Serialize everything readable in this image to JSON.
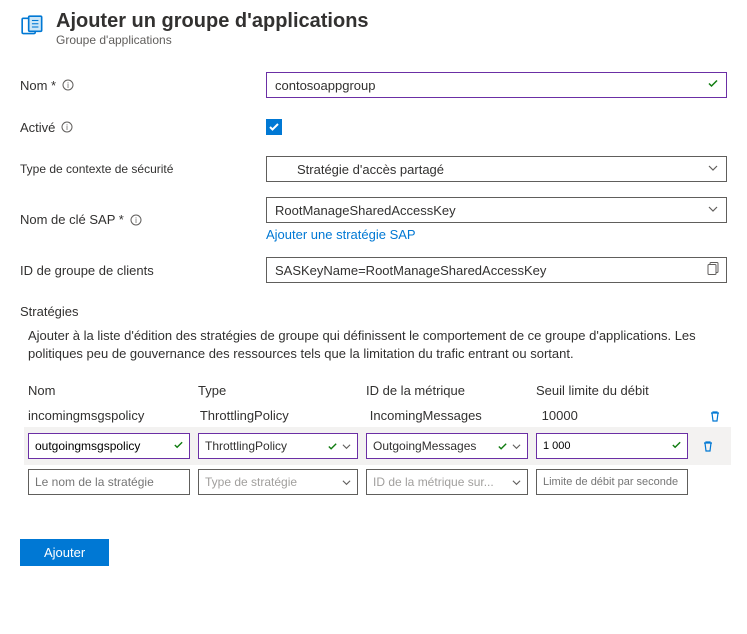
{
  "header": {
    "title": "Ajouter un groupe d'applications",
    "subtitle": "Groupe d'applications"
  },
  "fields": {
    "name_label": "Nom *",
    "name_value": "contosoappgroup",
    "enabled_label": "Activé",
    "enabled_checked": true,
    "context_label": "Type de contexte de sécurité",
    "context_value": "Stratégie d'accès partagé",
    "sap_label": "Nom de clé SAP *",
    "sap_value": "RootManageSharedAccessKey",
    "sap_link": "Ajouter une stratégie SAP",
    "client_label": "ID de groupe de clients",
    "client_value": "SASKeyName=RootManageSharedAccessKey"
  },
  "policies": {
    "section_title": "Stratégies",
    "section_desc": "Ajouter à la liste d'édition des stratégies de groupe qui définissent le comportement de ce groupe d'applications. Les politiques peu de gouvernance des ressources tels que la limitation du trafic entrant ou sortant.",
    "headers": {
      "name": "Nom",
      "type": "Type",
      "metric": "ID de la métrique",
      "threshold": "Seuil limite du débit"
    },
    "rows": [
      {
        "name": "incomingmsgspolicy",
        "type": "ThrottlingPolicy",
        "metric": "IncomingMessages",
        "threshold": "10000"
      },
      {
        "name": "outgoingmsgspolicy",
        "type": "ThrottlingPolicy",
        "metric": "OutgoingMessages",
        "threshold": "1 000"
      }
    ],
    "placeholders": {
      "name": "Le nom de la stratégie",
      "type": "Type de stratégie",
      "metric": "ID de la métrique sur...",
      "threshold": "Limite de débit par seconde"
    }
  },
  "footer": {
    "add_label": "Ajouter"
  }
}
